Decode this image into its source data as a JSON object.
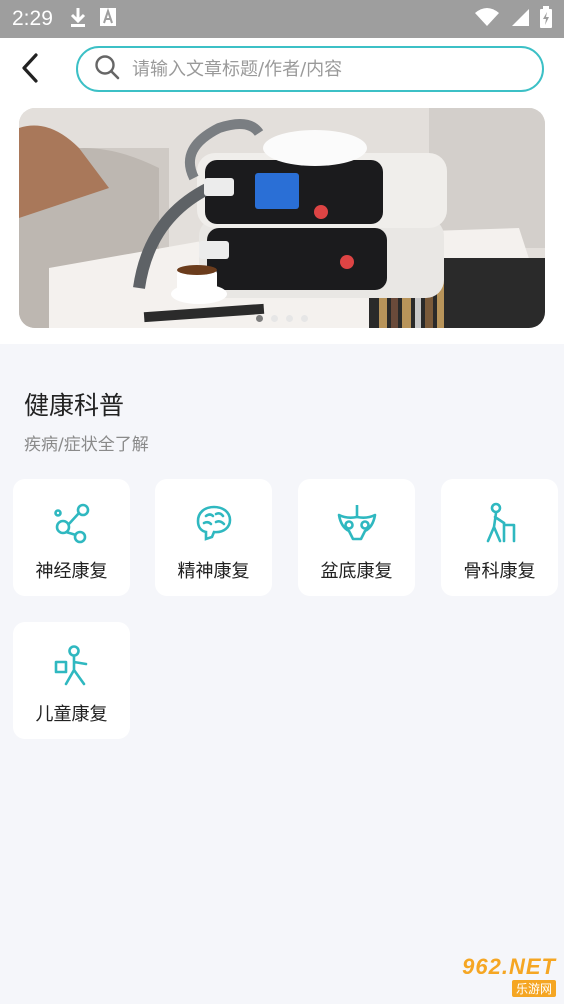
{
  "status_bar": {
    "time": "2:29",
    "icons": [
      "download-icon",
      "a-badge-icon",
      "wifi-icon",
      "signal-icon",
      "battery-icon"
    ]
  },
  "header": {
    "search_placeholder": "请输入文章标题/作者/内容"
  },
  "banner": {
    "slides_count": 4,
    "active_index": 0
  },
  "section": {
    "title": "健康科普",
    "subtitle": "疾病/症状全了解"
  },
  "categories": [
    {
      "label": "神经康复",
      "icon": "neuron-icon"
    },
    {
      "label": "精神康复",
      "icon": "brain-icon"
    },
    {
      "label": "盆底康复",
      "icon": "pelvis-icon"
    },
    {
      "label": "骨科康复",
      "icon": "walker-icon"
    },
    {
      "label": "儿童康复",
      "icon": "child-icon"
    }
  ],
  "watermark": {
    "top": "962.NET",
    "bottom": "乐游网"
  },
  "colors": {
    "accent": "#3cc0c6",
    "status_bar": "#9e9e9e",
    "background": "#f5f6fa"
  }
}
